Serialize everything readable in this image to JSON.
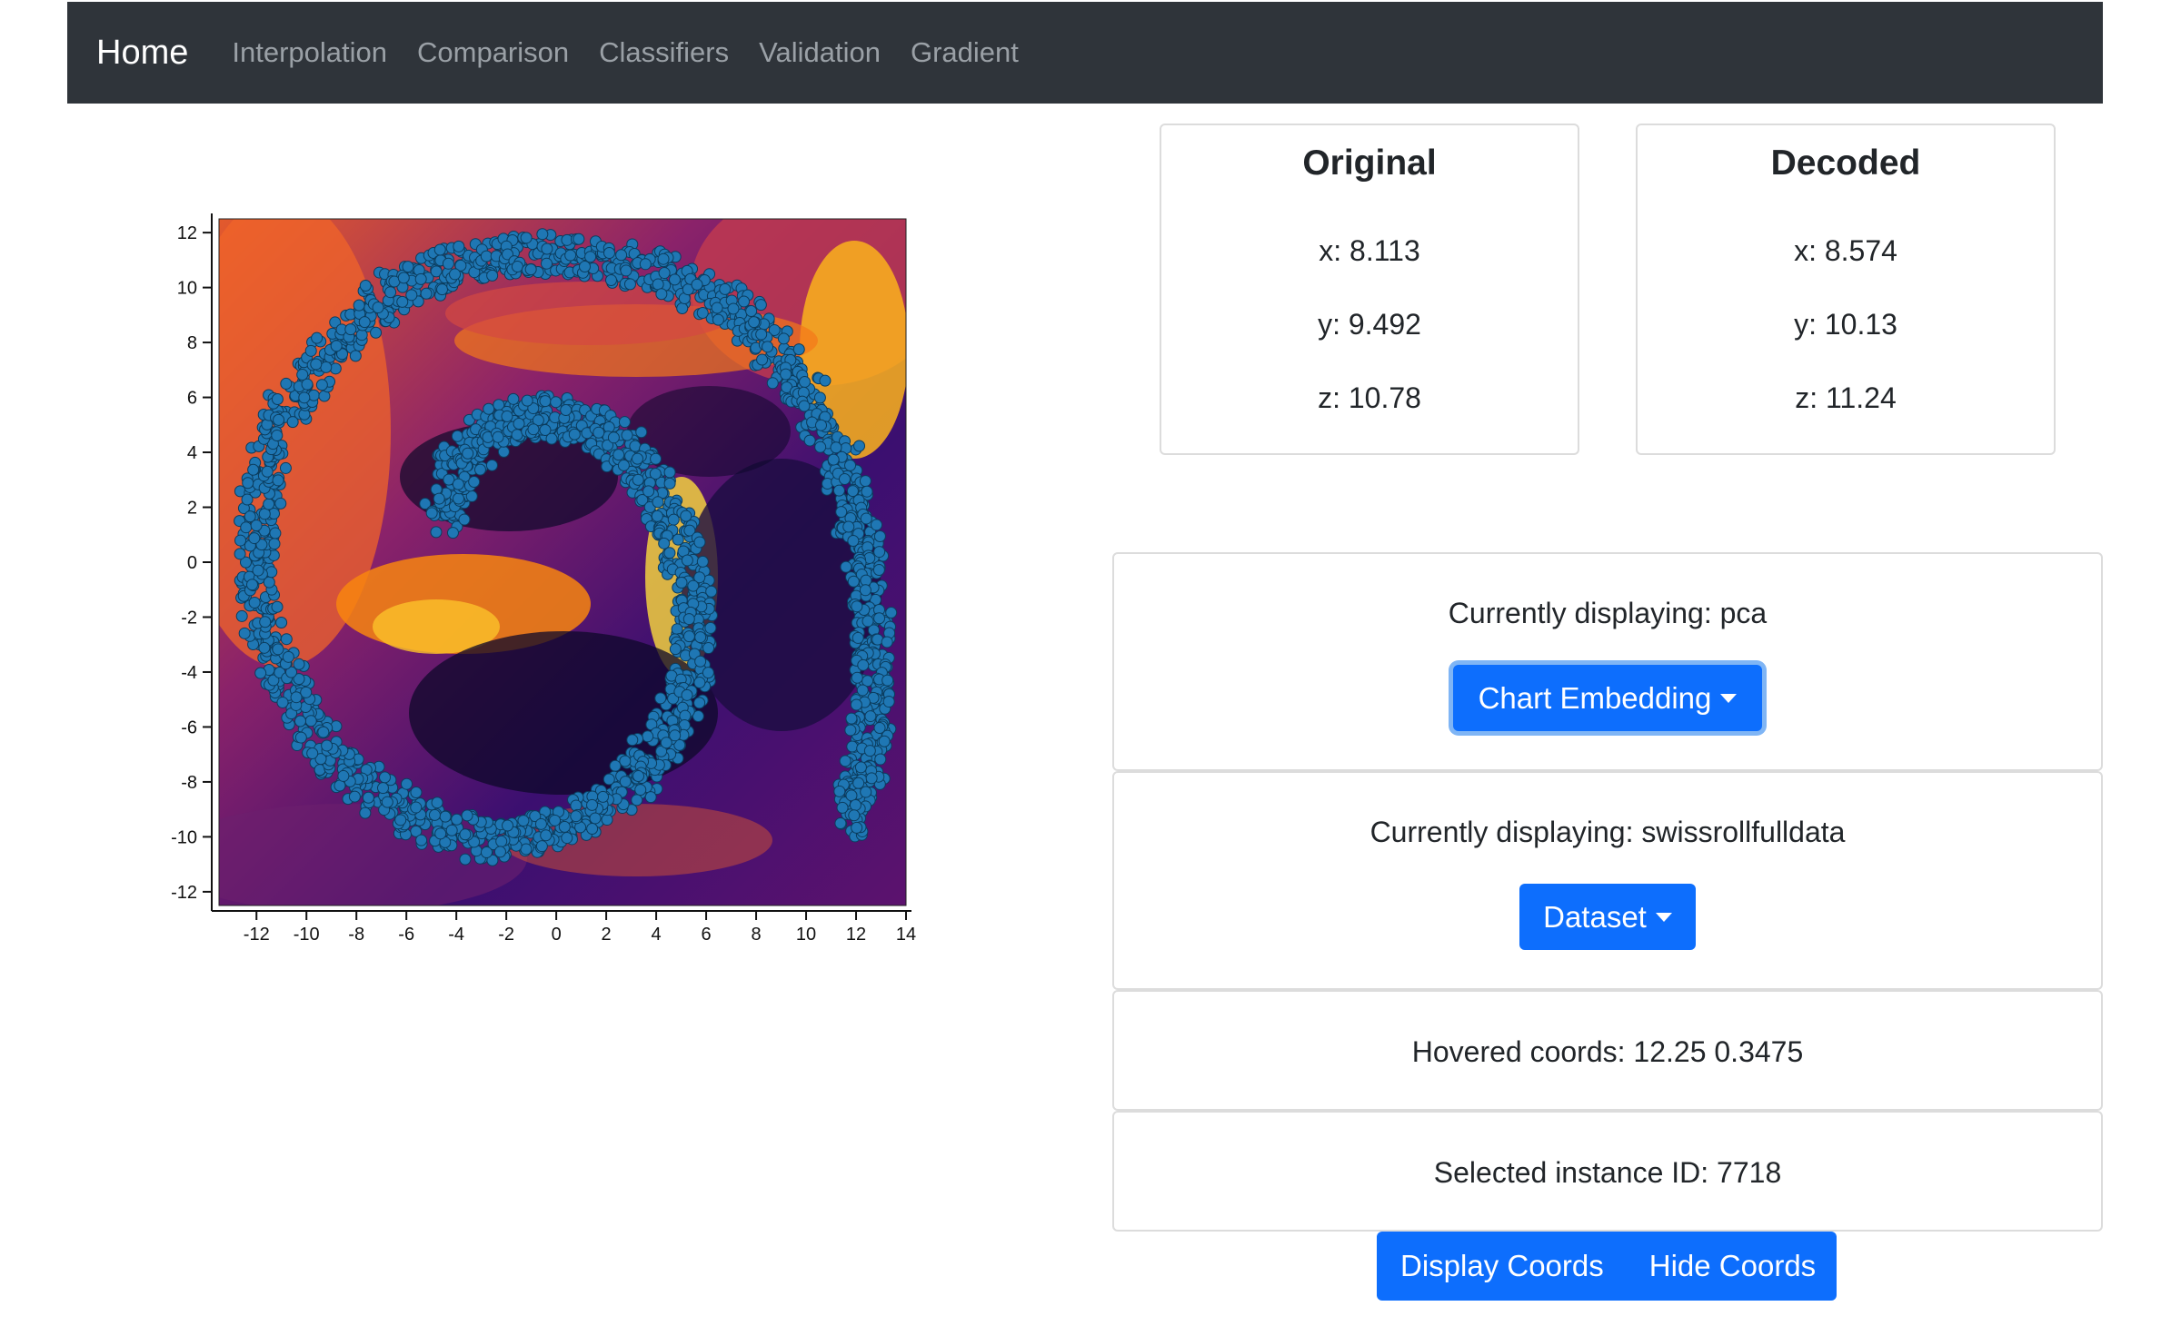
{
  "navbar": {
    "brand": "Home",
    "links": [
      "Interpolation",
      "Comparison",
      "Classifiers",
      "Validation",
      "Gradient"
    ]
  },
  "original": {
    "title": "Original",
    "x": "x: 8.113",
    "y": "y: 9.492",
    "z": "z: 10.78"
  },
  "decoded": {
    "title": "Decoded",
    "x": "x: 8.574",
    "y": "y: 10.13",
    "z": "z: 11.24"
  },
  "embedding_panel": {
    "status": "Currently displaying: pca",
    "button": "Chart Embedding"
  },
  "dataset_panel": {
    "status": "Currently displaying: swissrollfulldata",
    "button": "Dataset"
  },
  "hovered": {
    "text": "Hovered coords: 12.25 0.3475"
  },
  "selected": {
    "text": "Selected instance ID: 7718"
  },
  "coord_buttons": {
    "display": "Display Coords",
    "hide": "Hide Coords"
  },
  "colors": {
    "navbar": "#2f343a",
    "button_primary": "#0d6efd",
    "point_fill": "#1f77b4",
    "heatmap_dark": "#0d0829",
    "heatmap_bright": "#fcdc3c"
  },
  "chart_data": {
    "type": "scatter",
    "title": "",
    "xlabel": "",
    "ylabel": "",
    "xlim": [
      -13.5,
      14
    ],
    "ylim": [
      -12.5,
      12.5
    ],
    "x_ticks": [
      -12,
      -10,
      -8,
      -6,
      -4,
      -2,
      0,
      2,
      4,
      6,
      8,
      10,
      12,
      14
    ],
    "y_ticks": [
      12,
      10,
      8,
      6,
      4,
      2,
      0,
      -2,
      -4,
      -6,
      -8,
      -10,
      -12
    ],
    "background": "heatmap (inferno colormap)",
    "grid": false,
    "series": [
      {
        "values_description": "swiss roll 2D embedding",
        "points": [
          [
            -4.5,
            1.5
          ],
          [
            -3.9,
            3.6
          ],
          [
            -2.5,
            5.0
          ],
          [
            -0.5,
            5.4
          ],
          [
            1.5,
            4.9
          ],
          [
            3.3,
            3.6
          ],
          [
            4.8,
            1.3
          ],
          [
            5.6,
            -1.4
          ],
          [
            5.4,
            -4.2
          ],
          [
            4.3,
            -6.6
          ],
          [
            2.5,
            -8.6
          ],
          [
            0.0,
            -9.8
          ],
          [
            -2.8,
            -10.2
          ],
          [
            -5.8,
            -9.3
          ],
          [
            -8.6,
            -7.5
          ],
          [
            -10.6,
            -4.8
          ],
          [
            -11.9,
            -1.7
          ],
          [
            -12.0,
            1.6
          ],
          [
            -11.2,
            4.8
          ],
          [
            -9.4,
            7.6
          ],
          [
            -6.8,
            9.7
          ],
          [
            -3.8,
            10.9
          ],
          [
            -0.6,
            11.3
          ],
          [
            2.8,
            10.9
          ],
          [
            5.8,
            9.9
          ],
          [
            8.2,
            8.3
          ],
          [
            10.1,
            6.0
          ],
          [
            11.5,
            3.4
          ],
          [
            12.3,
            0.5
          ],
          [
            12.7,
            -2.4
          ],
          [
            12.7,
            -5.0
          ],
          [
            12.4,
            -7.5
          ],
          [
            11.7,
            -9.5
          ]
        ]
      }
    ]
  }
}
